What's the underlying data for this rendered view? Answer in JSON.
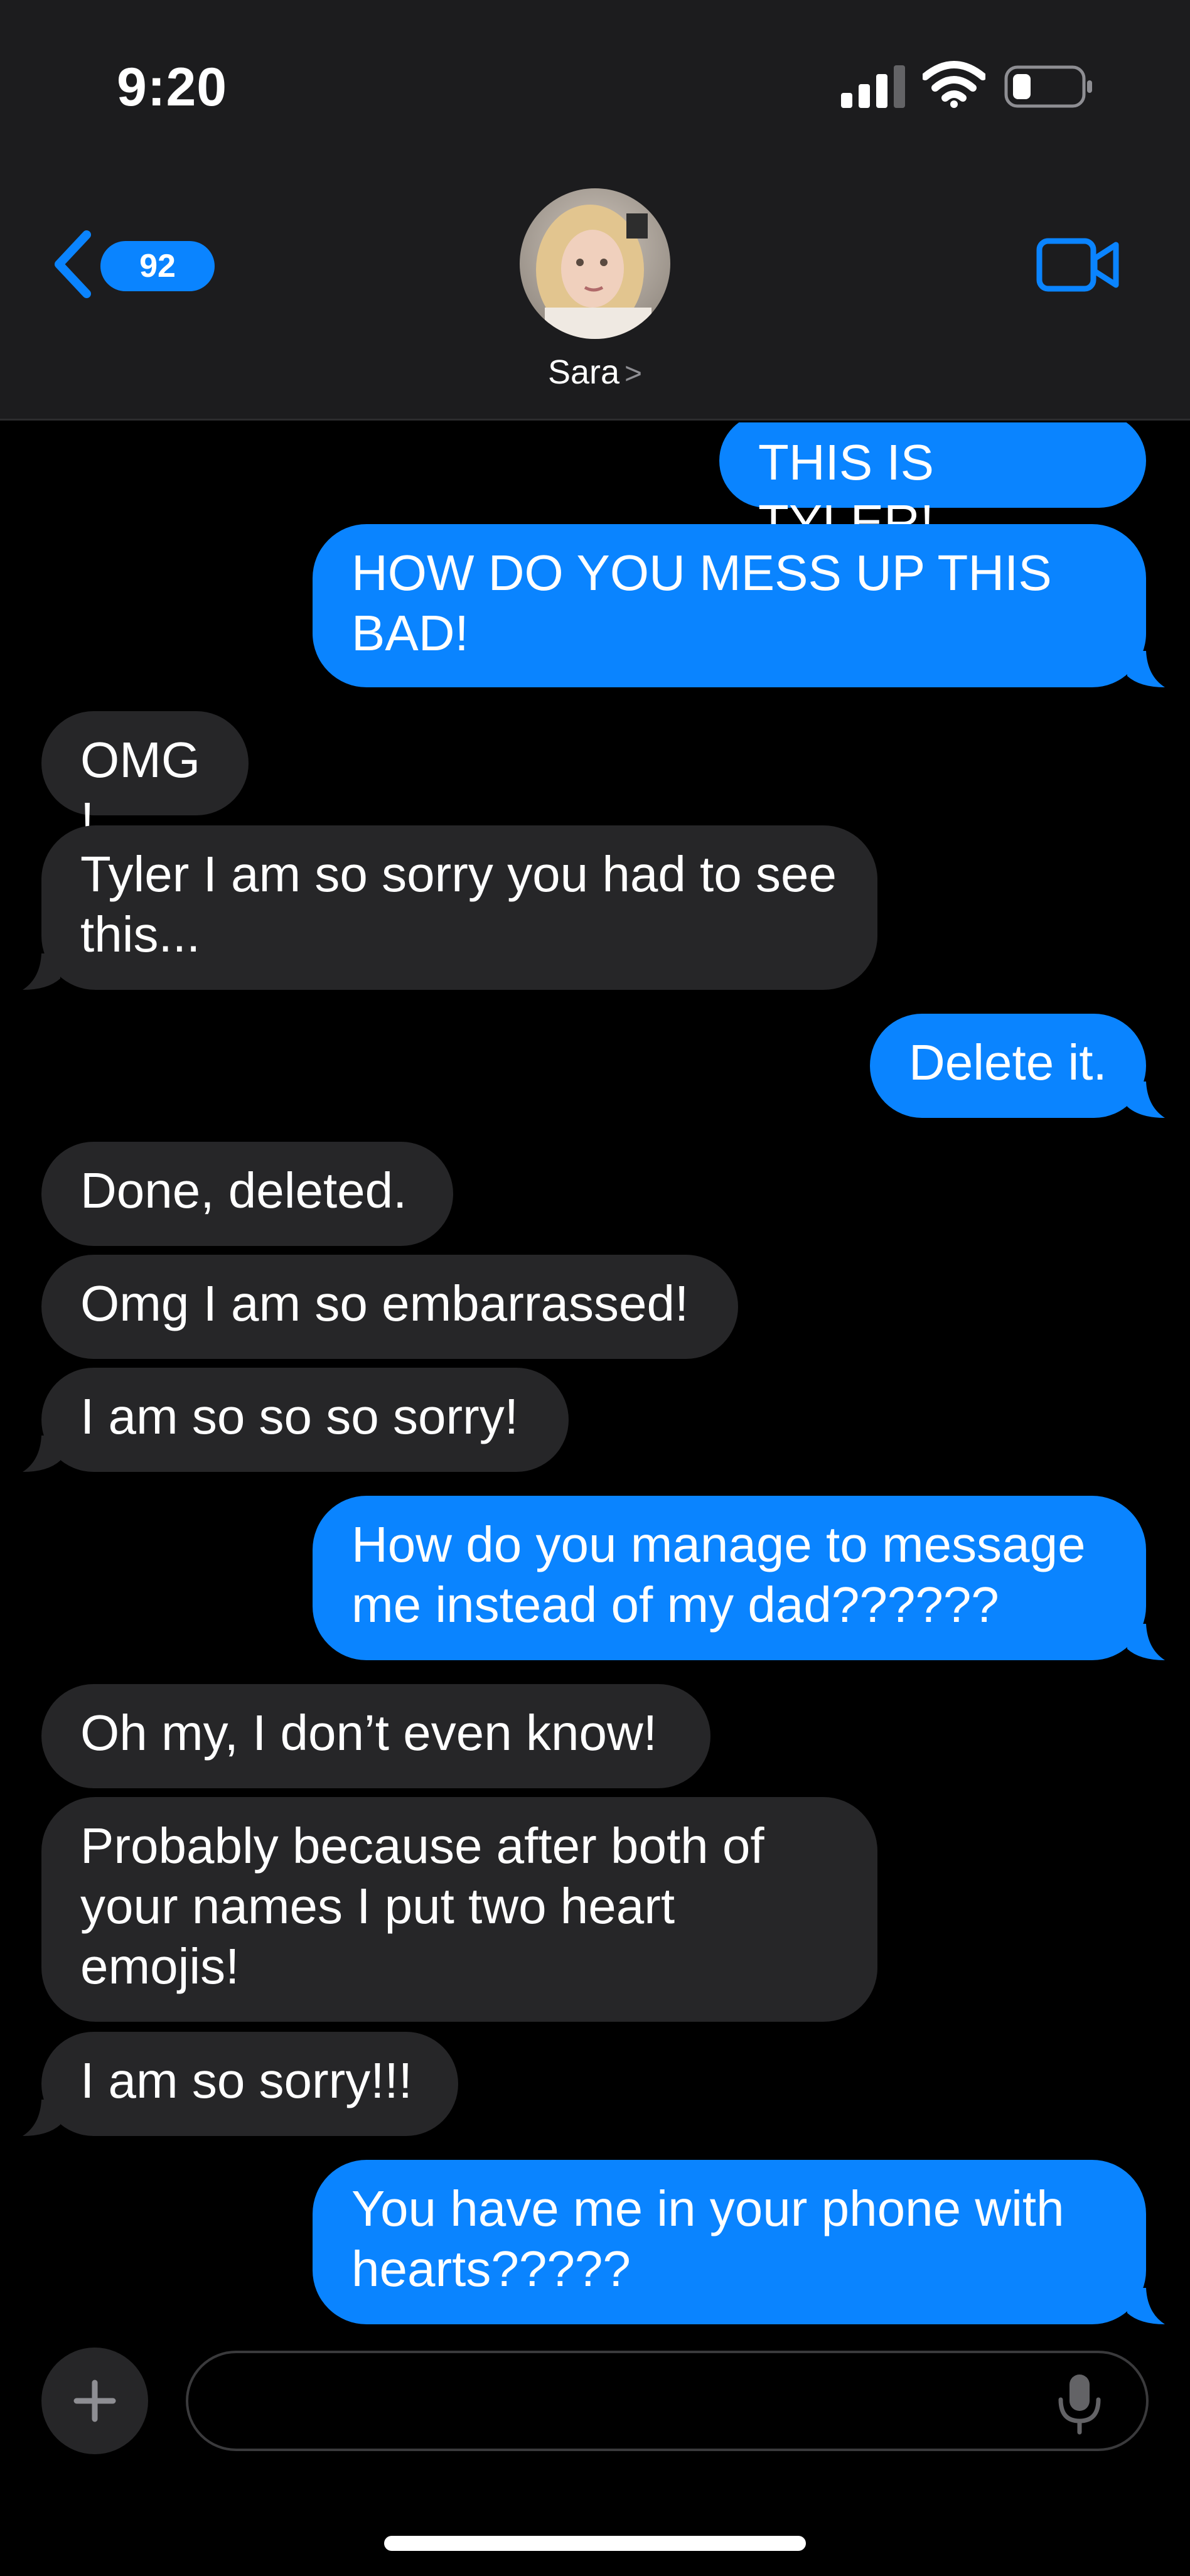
{
  "status_bar": {
    "time": "9:20",
    "signal_icon": "cellular-signal-icon",
    "wifi_icon": "wifi-icon",
    "battery_icon": "battery-low-icon",
    "battery_percent": 20
  },
  "header": {
    "back_badge": "92",
    "back_icon": "chevron-left-icon",
    "contact_name": "Sara",
    "contact_chevron": ">",
    "avatar_icon": "contact-photo",
    "video_icon": "video-camera-icon"
  },
  "messages": [
    {
      "from": "me",
      "text": "THIS IS TYLER!"
    },
    {
      "from": "me",
      "text": "HOW DO YOU MESS UP THIS BAD!"
    },
    {
      "from": "them",
      "text": "OMG!"
    },
    {
      "from": "them",
      "text": "Tyler I am so sorry you had to see this..."
    },
    {
      "from": "me",
      "text": "Delete it."
    },
    {
      "from": "them",
      "text": "Done, deleted."
    },
    {
      "from": "them",
      "text": "Omg I am so embarrassed!"
    },
    {
      "from": "them",
      "text": "I am so so so sorry!"
    },
    {
      "from": "me",
      "text": "How do you manage to message me instead of my dad??????"
    },
    {
      "from": "them",
      "text": "Oh my, I don’t even know!"
    },
    {
      "from": "them",
      "text": "Probably because after both of your names I put two heart emojis!"
    },
    {
      "from": "them",
      "text": "I am so sorry!!!"
    },
    {
      "from": "me",
      "text": "You have me in your phone with hearts?????"
    }
  ],
  "compose": {
    "add_icon": "plus-icon",
    "placeholder": "",
    "mic_icon": "microphone-icon"
  },
  "colors": {
    "sent_bubble": "#0a84ff",
    "received_bubble": "#262628",
    "background": "#000000",
    "header_bg": "#1c1c1e",
    "accent": "#0a84ff"
  }
}
